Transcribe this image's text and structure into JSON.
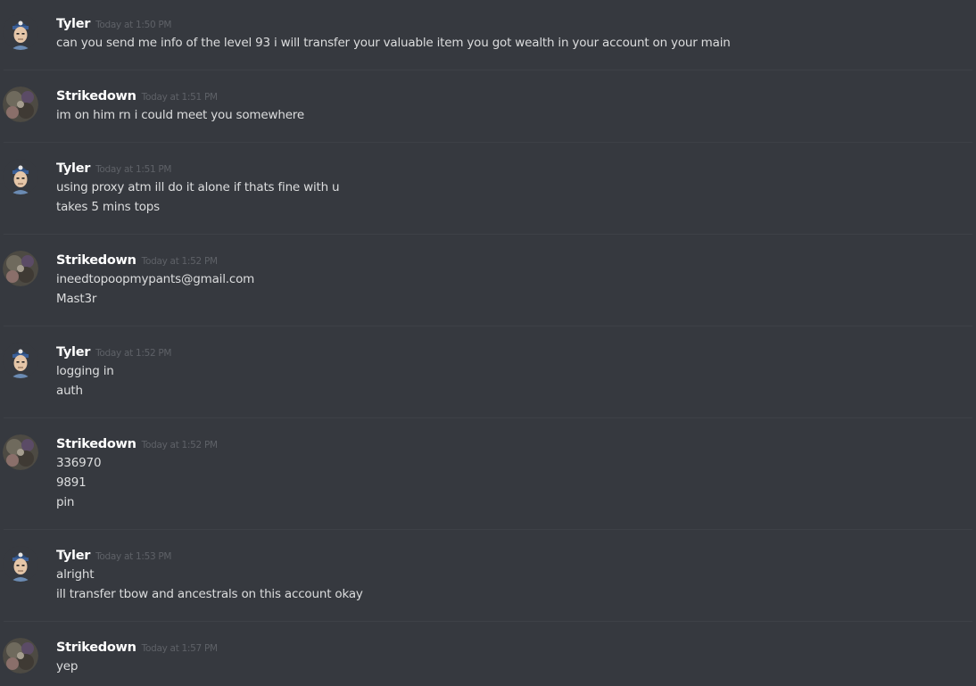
{
  "users": {
    "tyler": "Tyler",
    "strikedown": "Strikedown"
  },
  "messages": [
    {
      "author": "Tyler",
      "avatar": "tyler-avatar",
      "timestamp": "Today at 1:50 PM",
      "lines": [
        "can you send me info of the level 93 i will transfer your valuable item you got wealth in your account on your main"
      ]
    },
    {
      "author": "Strikedown",
      "avatar": "strikedown-avatar",
      "timestamp": "Today at 1:51 PM",
      "lines": [
        "im on him rn i could meet you somewhere"
      ]
    },
    {
      "author": "Tyler",
      "avatar": "tyler-avatar",
      "timestamp": "Today at 1:51 PM",
      "lines": [
        "using proxy atm ill do it alone if thats fine with u",
        "takes 5 mins tops"
      ]
    },
    {
      "author": "Strikedown",
      "avatar": "strikedown-avatar",
      "timestamp": "Today at 1:52 PM",
      "lines": [
        "ineedtopoopmypants@gmail.com",
        "Mast3r"
      ]
    },
    {
      "author": "Tyler",
      "avatar": "tyler-avatar",
      "timestamp": "Today at 1:52 PM",
      "lines": [
        "logging in",
        "auth"
      ]
    },
    {
      "author": "Strikedown",
      "avatar": "strikedown-avatar",
      "timestamp": "Today at 1:52 PM",
      "lines": [
        "336970",
        "9891",
        "pin"
      ]
    },
    {
      "author": "Tyler",
      "avatar": "tyler-avatar",
      "timestamp": "Today at 1:53 PM",
      "lines": [
        "alright",
        "ill transfer tbow and ancestrals on this account okay"
      ]
    },
    {
      "author": "Strikedown",
      "avatar": "strikedown-avatar",
      "timestamp": "Today at 1:57 PM",
      "lines": [
        "yep"
      ]
    }
  ],
  "colors": {
    "background": "#36393f",
    "divider": "#3e4147",
    "username": "#ffffff",
    "timestamp": "#5e6167",
    "text": "#dcddde"
  }
}
